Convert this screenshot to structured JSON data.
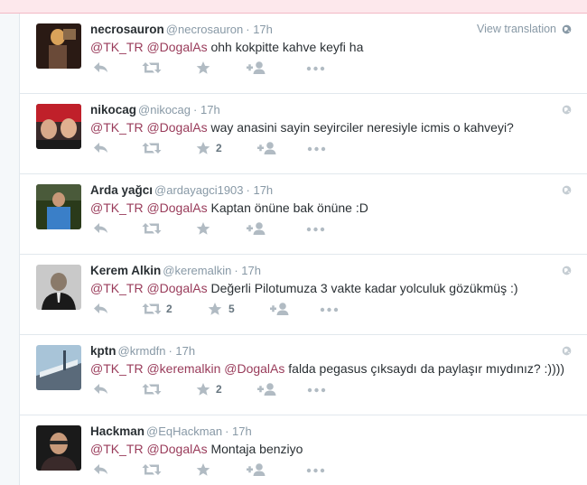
{
  "view_translation": "View translation",
  "tweets": [
    {
      "fullname": "necrosauron",
      "username": "@necrosauron",
      "time": "17h",
      "mentions": [
        "@TK_TR",
        "@DogalAs"
      ],
      "text": "ohh kokpitte kahve keyfi ha",
      "retweets": "",
      "favorites": "",
      "view_translation": true,
      "avatar_colors": [
        "#2a1a14",
        "#d9a25a"
      ]
    },
    {
      "fullname": "nikocag",
      "username": "@nikocag",
      "time": "17h",
      "mentions": [
        "@TK_TR",
        "@DogalAs"
      ],
      "text": "way anasini sayin seyirciler neresiyle icmis o kahveyi?",
      "retweets": "",
      "favorites": "2",
      "view_translation": false,
      "avatar_colors": [
        "#c0202a",
        "#3a2a2a"
      ]
    },
    {
      "fullname": "Arda yağcı",
      "username": "@ardayagci1903",
      "time": "17h",
      "mentions": [
        "@TK_TR",
        "@DogalAs"
      ],
      "text": "Kaptan önüne bak önüne :D",
      "retweets": "",
      "favorites": "",
      "view_translation": false,
      "avatar_colors": [
        "#3a7fc8",
        "#2a3a1a"
      ]
    },
    {
      "fullname": "Kerem Alkin",
      "username": "@keremalkin",
      "time": "17h",
      "mentions": [
        "@TK_TR",
        "@DogalAs"
      ],
      "text": "Değerli Pilotumuza 3 vakte kadar yolculuk gözükmüş :)",
      "retweets": "2",
      "favorites": "5",
      "view_translation": false,
      "avatar_colors": [
        "#c9c9c9",
        "#1a1a1a"
      ]
    },
    {
      "fullname": "kptn",
      "username": "@krmdfn",
      "time": "17h",
      "mentions": [
        "@TK_TR",
        "@keremalkin",
        "@DogalAs"
      ],
      "text": "falda pegasus çıksaydı da paylaşır mıydınız? :))))",
      "retweets": "",
      "favorites": "2",
      "view_translation": false,
      "avatar_colors": [
        "#a8c4d8",
        "#5a6a7a"
      ]
    },
    {
      "fullname": "Hackman",
      "username": "@EqHackman",
      "time": "17h",
      "mentions": [
        "@TK_TR",
        "@DogalAs"
      ],
      "text": "Montaja benziyo",
      "retweets": "",
      "favorites": "",
      "view_translation": false,
      "avatar_colors": [
        "#1a1a1a",
        "#c89a7a"
      ]
    }
  ],
  "icons": {
    "reply": "reply-icon",
    "retweet": "retweet-icon",
    "favorite": "star-icon",
    "follow": "follow-icon",
    "more": "more-icon",
    "globe": "globe-icon"
  },
  "colors": {
    "mention": "#993b5a",
    "username": "#8899a6",
    "icon": "#b1bbc3",
    "topbar": "#fde8ec"
  }
}
